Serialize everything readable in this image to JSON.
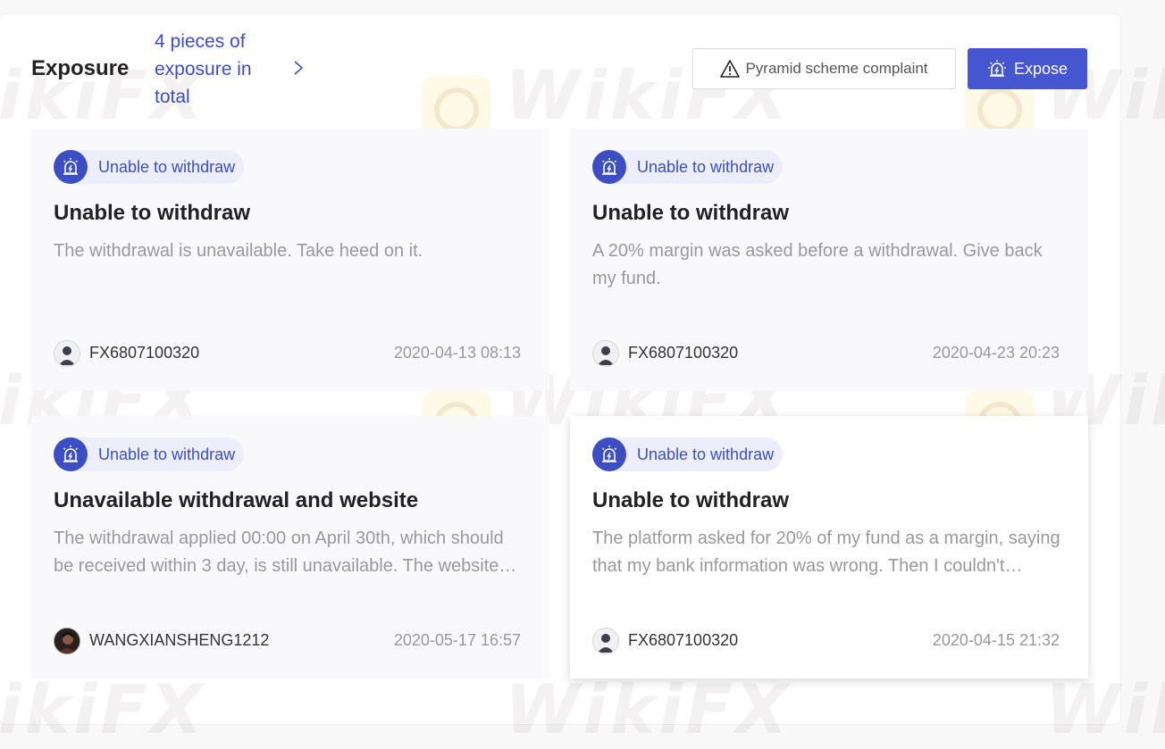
{
  "header": {
    "title": "Exposure",
    "count_text": "4 pieces of exposure in total",
    "complaint_label": "Pyramid scheme complaint",
    "expose_label": "Expose"
  },
  "watermark": {
    "text": "WikiFX"
  },
  "cards": [
    {
      "tag": "Unable to withdraw",
      "title": "Unable to withdraw",
      "description": "The withdrawal is unavailable. Take heed on it.",
      "user": "FX6807100320",
      "avatar": "default-avatar",
      "date": "2020-04-13 08:13"
    },
    {
      "tag": "Unable to withdraw",
      "title": "Unable to withdraw",
      "description": "A 20% margin was asked before a withdrawal. Give back my fund.",
      "user": "FX6807100320",
      "avatar": "default-avatar",
      "date": "2020-04-23 20:23"
    },
    {
      "tag": "Unable to withdraw",
      "title": "Unavailable withdrawal and website",
      "description": "The withdrawal applied 00:00 on April 30th, which should be received within 3 day, is still unavailable. The website can't be opened.",
      "user": "WANGXIANSHENG1212",
      "avatar": "photo-avatar",
      "date": "2020-05-17 16:57"
    },
    {
      "tag": "Unable to withdraw",
      "title": "Unable to withdraw",
      "description": "The platform asked for 20% of my fund as a margin, saying that my bank information was wrong. Then I couldn't withdraw.",
      "user": "FX6807100320",
      "avatar": "default-avatar",
      "date": "2020-04-15 21:32"
    }
  ],
  "colors": {
    "accent": "#3c4ec2",
    "button_primary": "#4556d0",
    "text_muted": "#999999"
  }
}
